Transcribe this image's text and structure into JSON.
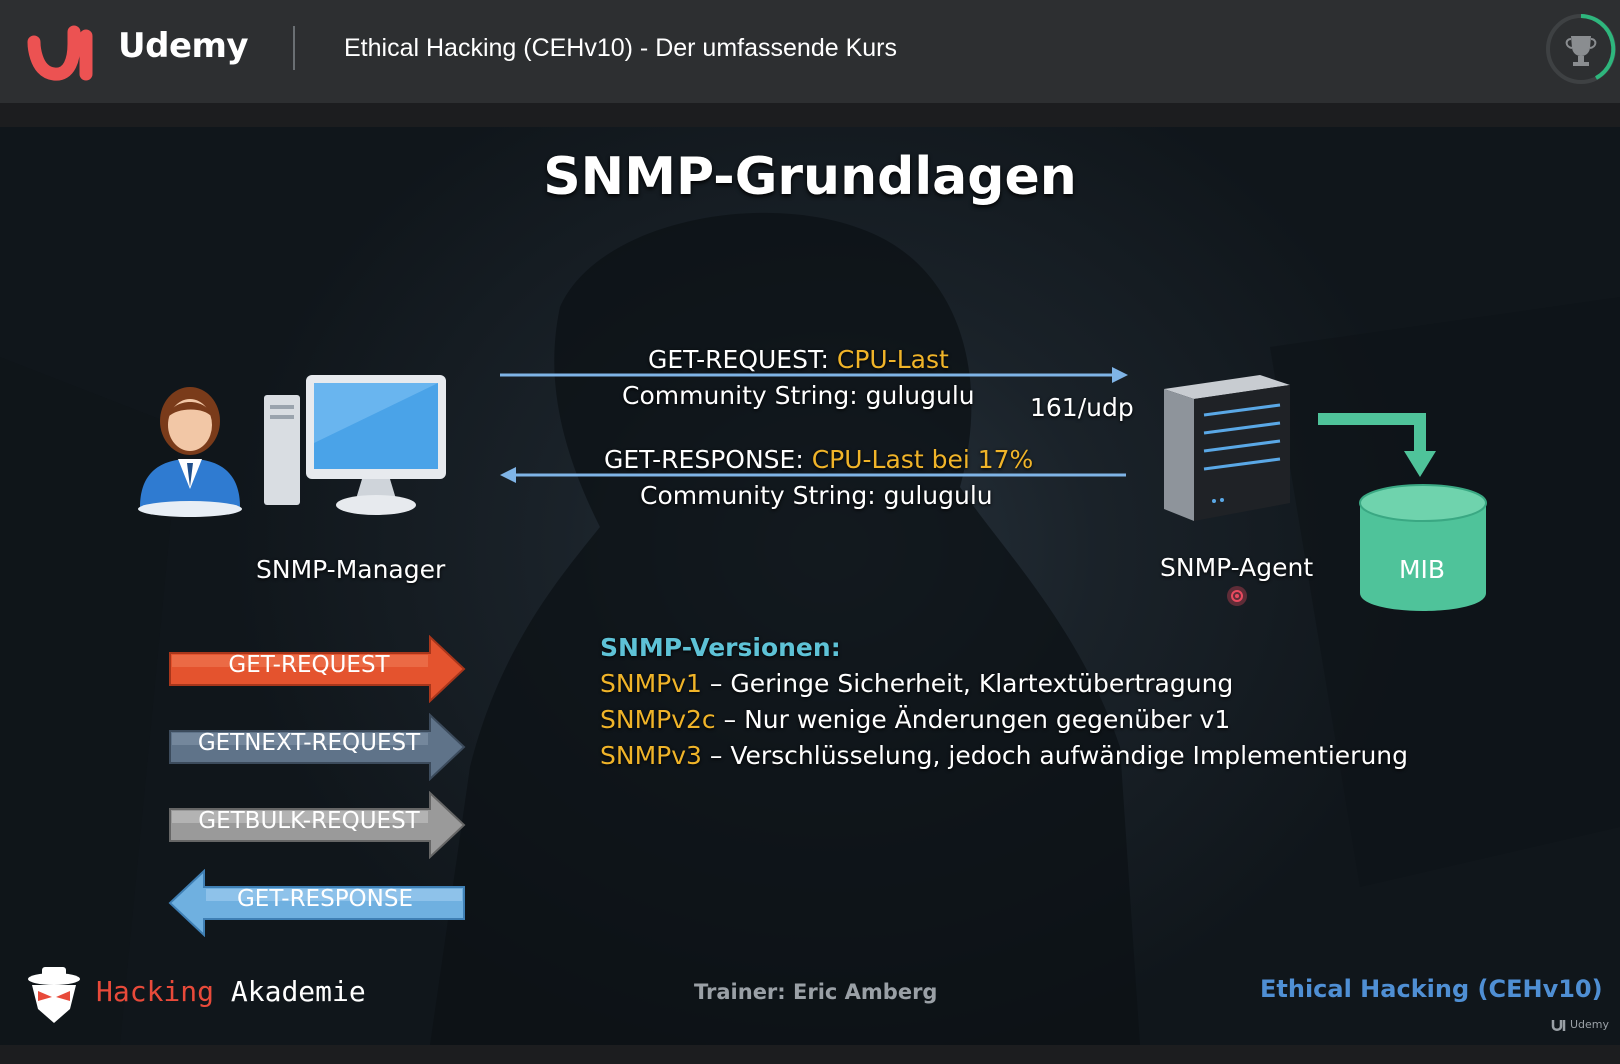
{
  "header": {
    "brand": "Udemy",
    "course_title": "Ethical Hacking (CEHv10) - Der umfassende Kurs"
  },
  "slide": {
    "title": "SNMP-Grundlagen",
    "request_line1_prefix": "GET-REQUEST: ",
    "request_line1_highlight": "CPU-Last",
    "request_line2": "Community String: gulugulu",
    "port": "161/udp",
    "response_line1_prefix": "GET-RESPONSE: ",
    "response_line1_highlight": "CPU-Last bei 17%",
    "response_line2": "Community String: gulugulu",
    "manager_label": "SNMP-Manager",
    "agent_label": "SNMP-Agent",
    "mib_label": "MIB",
    "pdu_buttons": [
      "GET-REQUEST",
      "GETNEXT-REQUEST",
      "GETBULK-REQUEST",
      "GET-RESPONSE"
    ],
    "versions_heading": "SNMP-Versionen:",
    "versions": [
      {
        "name": "SNMPv1",
        "desc": " – Geringe Sicherheit, Klartextübertragung"
      },
      {
        "name": "SNMPv2c",
        "desc": " – Nur wenige Änderungen gegenüber v1"
      },
      {
        "name": "SNMPv3",
        "desc": " – Verschlüsselung, jedoch aufwändige Implementierung"
      }
    ],
    "footer_logo_part1": "Hacking",
    "footer_logo_part2": " Akademie",
    "trainer": "Trainer: Eric Amberg",
    "footer_course": "Ethical Hacking (CEHv10)",
    "watermark": "Udemy"
  },
  "colors": {
    "accent_yellow": "#f0b429",
    "accent_cyan": "#5ec2d6",
    "get_request": "#e4532e",
    "getnext": "#5f7389",
    "getbulk": "#9a9a9a",
    "get_response": "#6fb0e0",
    "mib": "#4fc39a",
    "udemy_red": "#ec5252"
  }
}
